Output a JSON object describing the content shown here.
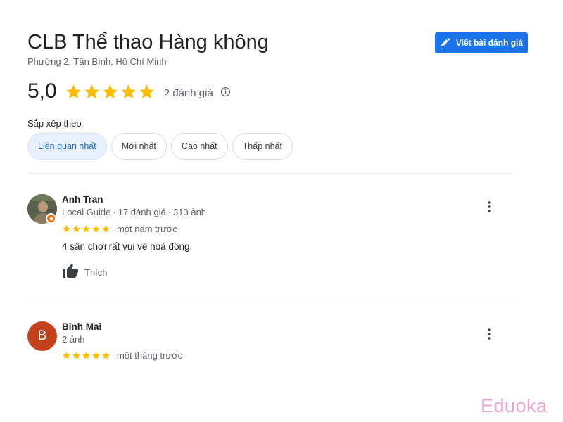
{
  "place": {
    "name": "CLB Thể thao Hàng không",
    "address": "Phường 2, Tân Bình, Hồ Chí Minh"
  },
  "write_review": {
    "label": "Viết bài đánh giá",
    "icon": "pencil-icon"
  },
  "rating": {
    "value": "5,0",
    "stars": 5,
    "review_count": "2 đánh giá",
    "star_color": "#fbbc04"
  },
  "sort": {
    "label": "Sắp xếp theo",
    "options": [
      "Liên quan nhất",
      "Mới nhất",
      "Cao nhất",
      "Thấp nhất"
    ],
    "selected": "Liên quan nhất"
  },
  "reviews": [
    {
      "name": "Anh Tran",
      "badge": "Local Guide",
      "review_count": "17 đánh giá",
      "photo_count": "313 ảnh",
      "stars": 5,
      "time": "một năm trước",
      "text": "4 sân chơi rất vui vẽ hoà đồng.",
      "like_label": "Thích",
      "avatar": "photo"
    },
    {
      "name": "Binh Mai",
      "photo_count": "2 ảnh",
      "stars": 5,
      "time": "một tháng trước",
      "avatar_letter": "B",
      "avatar_color": "#c5411c"
    }
  ],
  "watermark": "Eduoka",
  "colors": {
    "accent": "#1a73e8",
    "chip_active_bg": "#e8f0fe",
    "watermark": "#e7a4cf"
  }
}
